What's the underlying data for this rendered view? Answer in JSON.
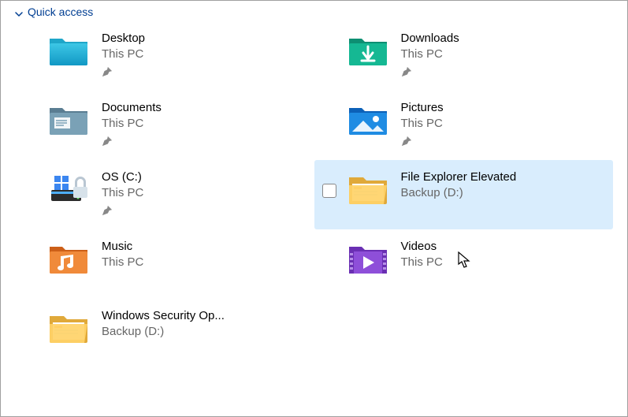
{
  "section": {
    "title": "Quick access"
  },
  "items": [
    {
      "title": "Desktop",
      "sub": "This PC",
      "pinned": true,
      "icon": "desktop"
    },
    {
      "title": "Downloads",
      "sub": "This PC",
      "pinned": true,
      "icon": "downloads"
    },
    {
      "title": "Documents",
      "sub": "This PC",
      "pinned": true,
      "icon": "documents"
    },
    {
      "title": "Pictures",
      "sub": "This PC",
      "pinned": true,
      "icon": "pictures"
    },
    {
      "title": "OS (C:)",
      "sub": "This PC",
      "pinned": true,
      "icon": "os-drive"
    },
    {
      "title": "File Explorer Elevated",
      "sub": "Backup (D:)",
      "pinned": false,
      "icon": "folder",
      "hovered": true,
      "checkbox": true
    },
    {
      "title": "Music",
      "sub": "This PC",
      "pinned": false,
      "icon": "music"
    },
    {
      "title": "Videos",
      "sub": "This PC",
      "pinned": false,
      "icon": "videos"
    },
    {
      "title": "Windows Security Op...",
      "sub": "Backup (D:)",
      "pinned": false,
      "icon": "folder"
    }
  ]
}
